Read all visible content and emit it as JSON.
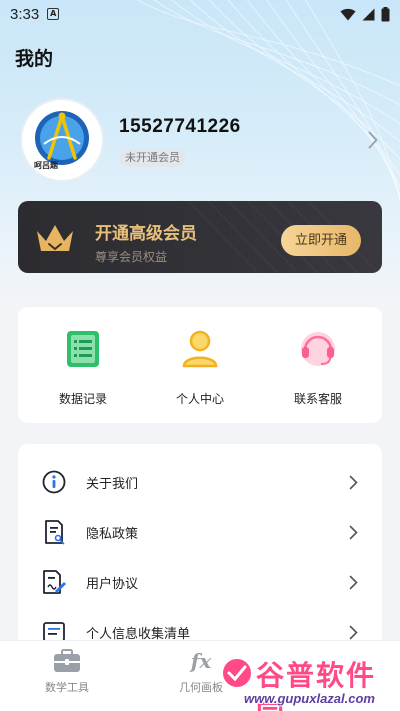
{
  "status_bar": {
    "time": "3:33",
    "notification_badge": "A"
  },
  "header": {
    "title": "我的"
  },
  "profile": {
    "phone": "15527741226",
    "membership_status": "未开通会员",
    "avatar_text": "呵吕题"
  },
  "vip": {
    "title": "开通高级会员",
    "subtitle": "尊享会员权益",
    "button_label": "立即开通",
    "colors": {
      "gold": "#e9c07a",
      "card": "#2f2f34"
    }
  },
  "quick_actions": [
    {
      "label": "数据记录",
      "icon": "document-list-icon",
      "color": "#2fbf6a"
    },
    {
      "label": "个人中心",
      "icon": "person-icon",
      "color": "#f7c531"
    },
    {
      "label": "联系客服",
      "icon": "headset-icon",
      "color": "#ff6f9a"
    }
  ],
  "menu": [
    {
      "label": "关于我们",
      "icon": "info-icon"
    },
    {
      "label": "隐私政策",
      "icon": "privacy-key-icon"
    },
    {
      "label": "用户协议",
      "icon": "agreement-pen-icon"
    },
    {
      "label": "个人信息收集清单",
      "icon": "list-icon"
    }
  ],
  "tab_bar": [
    {
      "label": "数学工具",
      "icon": "toolbox-icon"
    },
    {
      "label": "几何画板",
      "icon": "fx-icon"
    }
  ],
  "watermark": {
    "title": "谷普软件园",
    "url": "www.gupuxlazal.com"
  }
}
